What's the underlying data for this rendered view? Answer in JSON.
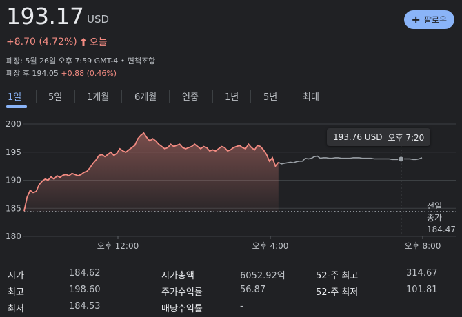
{
  "quote": {
    "price": "193.17",
    "currency": "USD",
    "change": "+8.70 (4.72%)",
    "period": "오늘",
    "closed_line": "폐장: 5월 26일 오후 7:59 GMT-4 • 면책조항",
    "after_hours_label": "폐장 후",
    "after_hours_price": "194.05",
    "after_hours_change": "+0.88 (0.46%)"
  },
  "follow_label": "팔로우",
  "tabs": [
    "1일",
    "5일",
    "1개월",
    "6개월",
    "연중",
    "1년",
    "5년",
    "최대"
  ],
  "active_tab": "1일",
  "colors": {
    "up": "#f28b82",
    "accent": "#8ab4f8",
    "after_hours_line": "#9aa0a6",
    "bg": "#202124"
  },
  "chart_data": {
    "type": "line",
    "y_ticks": [
      "200",
      "195",
      "190",
      "185",
      "180"
    ],
    "ylim": [
      180,
      200
    ],
    "x_ticks": [
      "오후 12:00",
      "오후 4:00",
      "오후 8:00"
    ],
    "prev_close": 184.47,
    "prev_close_label": [
      "전일",
      "종가",
      "184.47"
    ],
    "tooltip": {
      "price": "193.76 USD",
      "time": "오후 7:20"
    },
    "series": [
      {
        "session": "regular",
        "values": [
          184.5,
          187.0,
          188.2,
          187.8,
          188.0,
          189.2,
          189.8,
          190.2,
          190.0,
          190.6,
          190.2,
          190.8,
          190.5,
          190.9,
          191.0,
          190.8,
          191.2,
          191.0,
          190.8,
          191.0,
          191.4,
          191.6,
          192.2,
          193.0,
          193.6,
          194.4,
          194.6,
          194.2,
          194.6,
          195.0,
          194.4,
          194.8,
          195.6,
          195.2,
          195.0,
          195.4,
          195.8,
          196.2,
          197.4,
          198.0,
          198.4,
          197.6,
          197.0,
          197.4,
          197.0,
          196.4,
          196.0,
          195.6,
          195.8,
          196.4,
          196.0,
          196.2,
          196.4,
          195.8,
          195.6,
          195.8,
          196.0,
          196.4,
          196.0,
          195.6,
          196.0,
          195.8,
          195.2,
          195.4,
          195.2,
          195.6,
          196.0,
          195.8,
          195.2,
          195.4,
          195.8,
          196.0,
          196.2,
          195.8,
          195.6,
          196.4,
          195.8,
          195.4,
          196.2,
          196.0,
          195.4,
          194.6,
          193.4,
          194.0,
          192.5,
          193.2
        ]
      },
      {
        "session": "after_hours",
        "values": [
          193.2,
          192.9,
          193.0,
          193.1,
          193.2,
          193.1,
          193.3,
          193.4,
          193.4,
          193.9,
          193.8,
          193.9,
          194.2,
          194.3,
          193.9,
          194.0,
          194.0,
          193.9,
          193.9,
          194.0,
          194.0,
          193.9,
          193.9,
          193.9,
          193.9,
          194.0,
          194.0,
          194.0,
          193.9,
          193.9,
          193.9,
          193.9,
          193.8,
          193.8,
          193.8,
          193.8,
          193.8,
          193.8,
          193.7,
          193.7,
          193.7,
          193.8,
          193.8,
          193.8,
          193.8,
          193.7,
          193.7,
          193.8,
          194.0
        ]
      }
    ]
  },
  "stats": [
    {
      "label": "시가",
      "value": "184.62"
    },
    {
      "label": "최고",
      "value": "198.60"
    },
    {
      "label": "최저",
      "value": "184.53"
    },
    {
      "label": "시가총액",
      "value": "6052.92억"
    },
    {
      "label": "주가수익률",
      "value": "56.87"
    },
    {
      "label": "배당수익률",
      "value": "-"
    },
    {
      "label": "52-주 최고",
      "value": "314.67"
    },
    {
      "label": "52-주 최저",
      "value": "101.81"
    }
  ]
}
